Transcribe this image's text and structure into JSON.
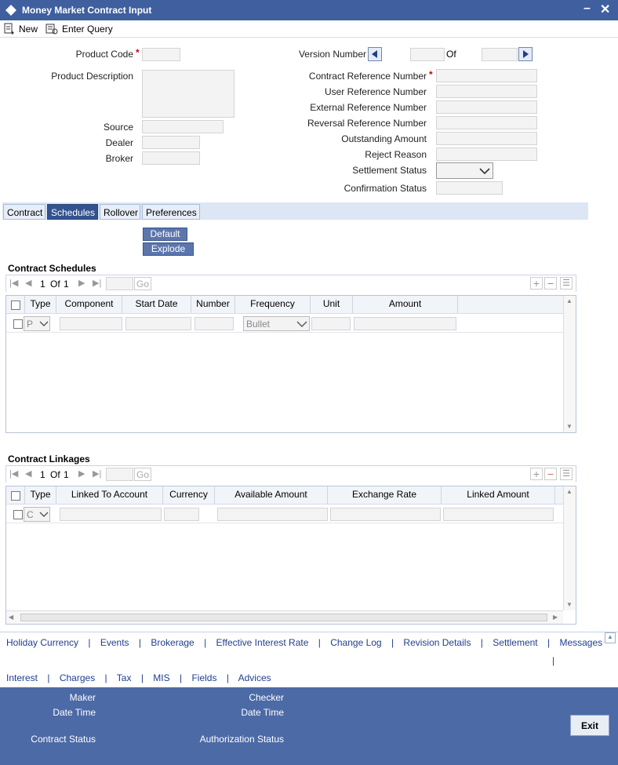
{
  "window": {
    "title": "Money Market Contract Input"
  },
  "toolbar": {
    "new_label": "New",
    "enter_query_label": "Enter Query"
  },
  "header": {
    "product_code_label": "Product Code",
    "product_description_label": "Product Description",
    "source_label": "Source",
    "dealer_label": "Dealer",
    "broker_label": "Broker",
    "version_number_label": "Version Number",
    "of_label": "Of",
    "contract_reference_label": "Contract Reference Number",
    "user_reference_label": "User Reference Number",
    "external_reference_label": "External Reference Number",
    "reversal_reference_label": "Reversal Reference Number",
    "outstanding_amount_label": "Outstanding Amount",
    "reject_reason_label": "Reject Reason",
    "settlement_status_label": "Settlement Status",
    "confirmation_status_label": "Confirmation Status",
    "required_mark": "*"
  },
  "tabs": [
    {
      "label": "Contract"
    },
    {
      "label": "Schedules"
    },
    {
      "label": "Rollover"
    },
    {
      "label": "Preferences"
    }
  ],
  "schedules_actions": {
    "default_label": "Default",
    "explode_label": "Explode"
  },
  "contract_schedules": {
    "title": "Contract Schedules",
    "pager": {
      "current": "1",
      "of_text": "Of",
      "total": "1",
      "go_label": "Go"
    },
    "columns": [
      "Type",
      "Component",
      "Start Date",
      "Number",
      "Frequency",
      "Unit",
      "Amount"
    ],
    "row": {
      "type_value": "P",
      "frequency_value": "Bullet"
    }
  },
  "contract_linkages": {
    "title": "Contract Linkages",
    "pager": {
      "current": "1",
      "of_text": "Of",
      "total": "1",
      "go_label": "Go"
    },
    "columns": [
      "Type",
      "Linked To Account",
      "Currency",
      "Available Amount",
      "Exchange Rate",
      "Linked Amount"
    ],
    "row": {
      "type_value": "C"
    }
  },
  "bottom_links_row1": [
    "Holiday Currency",
    "Events",
    "Brokerage",
    "Effective Interest Rate",
    "Change Log",
    "Revision Details",
    "Settlement",
    "Messages"
  ],
  "bottom_links_row2": [
    "Interest",
    "Charges",
    "Tax",
    "MIS",
    "Fields",
    "Advices"
  ],
  "separator": "|",
  "footer": {
    "maker_label": "Maker",
    "maker_datetime_label": "Date Time",
    "checker_label": "Checker",
    "checker_datetime_label": "Date Time",
    "contract_status_label": "Contract Status",
    "authorization_status_label": "Authorization Status",
    "exit_label": "Exit"
  },
  "colors": {
    "title_bar": "#3f5f9f",
    "footer": "#4c6aa6",
    "active_tab": "#33538f",
    "link": "#1f3f8f",
    "required": "#cc0000"
  }
}
